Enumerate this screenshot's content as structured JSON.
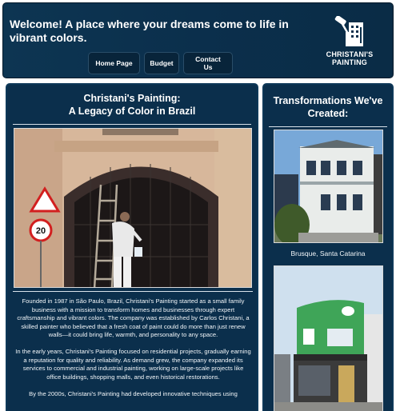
{
  "header": {
    "title": "Welcome! A place where your dreams come to life in vibrant colors.",
    "logo_text_line1": "CHRISTANI'S",
    "logo_text_line2": "PAINTING",
    "logo_icon": "paint-roller-building-icon"
  },
  "nav": {
    "items": [
      {
        "label": "Home Page"
      },
      {
        "label": "Budget"
      },
      {
        "label": "Contact Us"
      }
    ]
  },
  "left_panel": {
    "title_line1": "Christani's Painting:",
    "title_line2": "A Legacy of Color in Brazil",
    "paragraphs": [
      "Founded in 1987 in São Paulo, Brazil, Christani's Painting started as a small family business with a mission to transform homes and businesses through expert craftsmanship and vibrant colors. The company was established by Carlos Christani, a skilled painter who believed that a fresh coat of paint could do more than just renew walls—it could bring life, warmth, and personality to any space.",
      "In the early years, Christani's Painting focused on residential projects, gradually earning a reputation for quality and reliability. As demand grew, the company expanded its services to commercial and industrial painting, working on large-scale projects like office buildings, shopping malls, and even historical restorations.",
      "By the 2000s, Christani's Painting had developed innovative techniques using"
    ]
  },
  "right_panel": {
    "title_line1": "Transformations We've",
    "title_line2": "Created:",
    "gallery": [
      {
        "caption": "Brusque, Santa Catarina"
      },
      {
        "caption": ""
      }
    ]
  },
  "colors": {
    "navy": "#0b2f4c",
    "button": "#08243a",
    "text": "#ffffff"
  }
}
